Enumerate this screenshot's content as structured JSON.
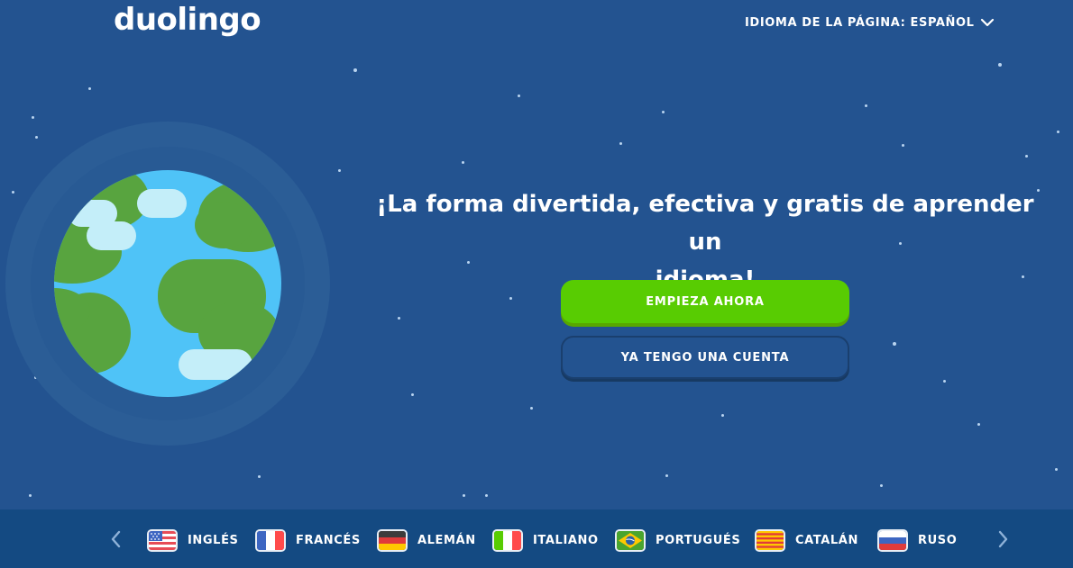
{
  "header": {
    "logo_text": "duolingo",
    "language_selector_label": "IDIOMA DE LA PÁGINA: ESPAÑOL"
  },
  "hero": {
    "title_line1": "¡La forma divertida, efectiva y gratis de aprender un",
    "title_line2": "idioma!",
    "primary_button": "EMPIEZA AHORA",
    "secondary_button": "YA TENGO UNA CUENTA"
  },
  "language_bar": {
    "items": [
      {
        "label": "INGLÉS",
        "flag": "us-flag-icon"
      },
      {
        "label": "FRANCÉS",
        "flag": "france-flag-icon"
      },
      {
        "label": "ALEMÁN",
        "flag": "germany-flag-icon"
      },
      {
        "label": "ITALIANO",
        "flag": "italy-flag-icon"
      },
      {
        "label": "PORTUGUÉS",
        "flag": "brazil-flag-icon"
      },
      {
        "label": "CATALÁN",
        "flag": "catalonia-flag-icon"
      },
      {
        "label": "RUSO",
        "flag": "russia-flag-icon"
      }
    ],
    "prev_icon": "chevron-left-icon",
    "next_icon": "chevron-right-icon"
  },
  "colors": {
    "background": "#235390",
    "primary_button": "#58cc02",
    "language_bar": "#144a82"
  }
}
